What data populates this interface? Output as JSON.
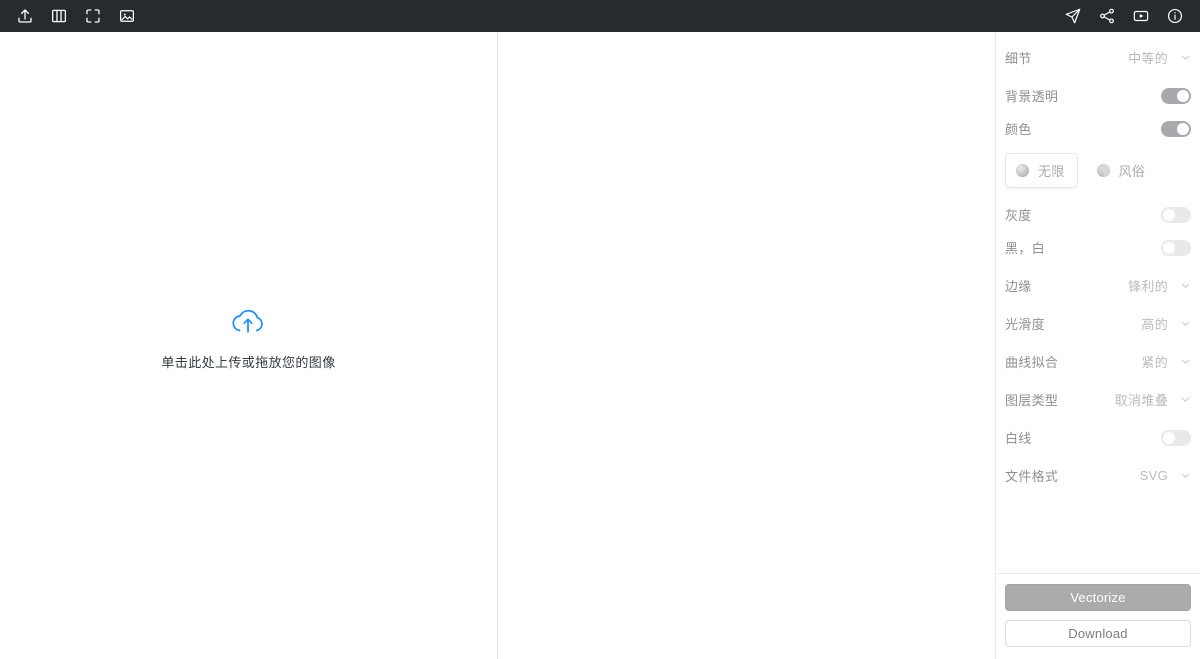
{
  "toolbar": {
    "left_items": [
      {
        "name": "upload-icon",
        "label": "Upload"
      },
      {
        "name": "split-view-icon",
        "label": "Split view"
      },
      {
        "name": "fullscreen-icon",
        "label": "Fullscreen"
      },
      {
        "name": "image-icon",
        "label": "Image"
      }
    ],
    "right_items": [
      {
        "name": "send-icon",
        "label": "Send"
      },
      {
        "name": "share-icon",
        "label": "Share"
      },
      {
        "name": "video-icon",
        "label": "Video"
      },
      {
        "name": "info-icon",
        "label": "Info"
      }
    ],
    "background_color": "#272b30",
    "icon_color": "#ffffff"
  },
  "upload": {
    "icon": "cloud-upload-icon",
    "icon_color": "#1890ff",
    "text": "单击此处上传或拖放您的图像"
  },
  "settings": {
    "detail": {
      "label": "细节",
      "value": "中等的",
      "control": "dropdown"
    },
    "transparent_bg": {
      "label": "背景透明",
      "state": "on",
      "control": "toggle"
    },
    "color": {
      "label": "颜色",
      "state": "on",
      "control": "toggle"
    },
    "modes": [
      {
        "label": "无限",
        "icon": "sphere-icon",
        "selected": true
      },
      {
        "label": "风俗",
        "icon": "sphere-icon",
        "selected": false
      }
    ],
    "grayscale": {
      "label": "灰度",
      "state": "off",
      "control": "toggle"
    },
    "black_white": {
      "label": "黑，白",
      "state": "off",
      "control": "toggle"
    },
    "edges": {
      "label": "边缘",
      "value": "锋利的",
      "control": "dropdown"
    },
    "smoothness": {
      "label": "光滑度",
      "value": "高的",
      "control": "dropdown"
    },
    "curve_fit": {
      "label": "曲线拟合",
      "value": "紧的",
      "control": "dropdown"
    },
    "layer_type": {
      "label": "图层类型",
      "value": "取消堆叠",
      "control": "dropdown"
    },
    "white_lines": {
      "label": "白线",
      "state": "off",
      "control": "toggle"
    },
    "file_format": {
      "label": "文件格式",
      "value": "SVG",
      "control": "dropdown"
    }
  },
  "footer": {
    "vectorize_label": "Vectorize",
    "download_label": "Download",
    "primary_color": "#aaabad"
  }
}
